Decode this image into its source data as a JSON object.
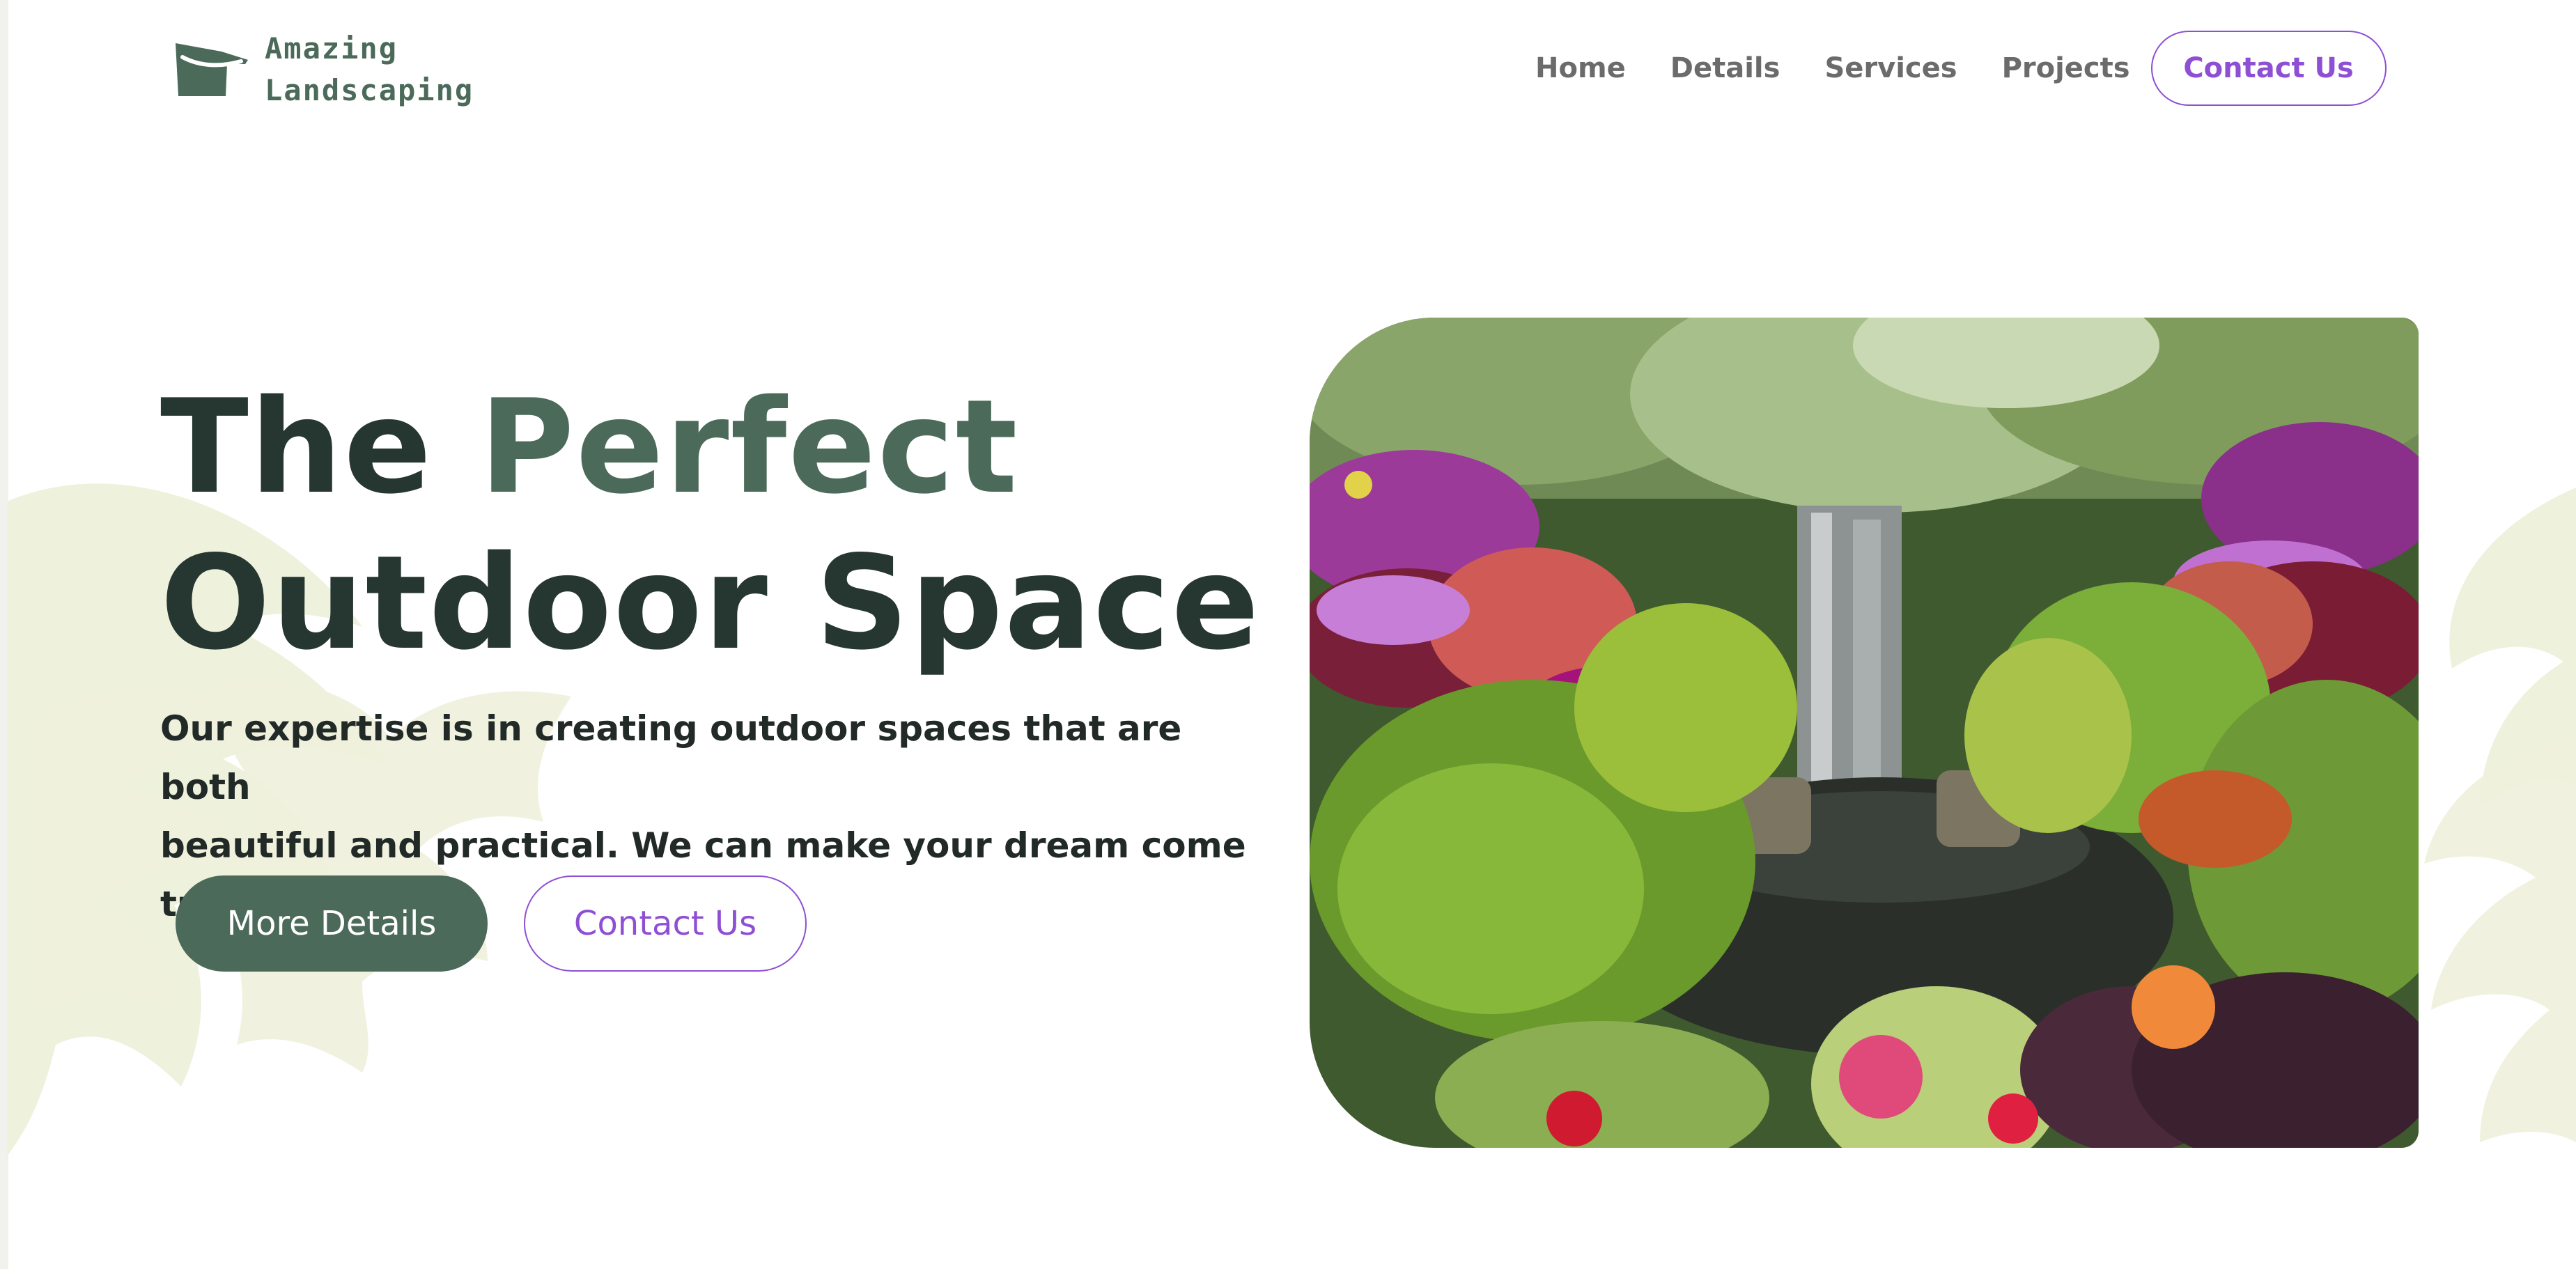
{
  "brand": {
    "line1": "Amazing",
    "line2": "Landscaping"
  },
  "nav": {
    "items": [
      {
        "label": "Home"
      },
      {
        "label": "Details"
      },
      {
        "label": "Services"
      },
      {
        "label": "Projects"
      }
    ],
    "cta_label": "Contact Us"
  },
  "hero": {
    "title_part1": "The ",
    "title_accent": "Perfect",
    "title_line2": "Outdoor Space",
    "subtitle_line1": "Our expertise is in creating outdoor spaces that are both",
    "subtitle_line2": "beautiful and practical. We can make your dream come true.",
    "primary_button": "More Details",
    "secondary_button": "Contact Us"
  },
  "colors": {
    "brand_green": "#4b6a5a",
    "dark_text": "#263630",
    "accent_purple": "#8e4fd4",
    "leaf_tint": "#eef1dc"
  },
  "icons": {
    "logo": "watering-can-icon"
  }
}
